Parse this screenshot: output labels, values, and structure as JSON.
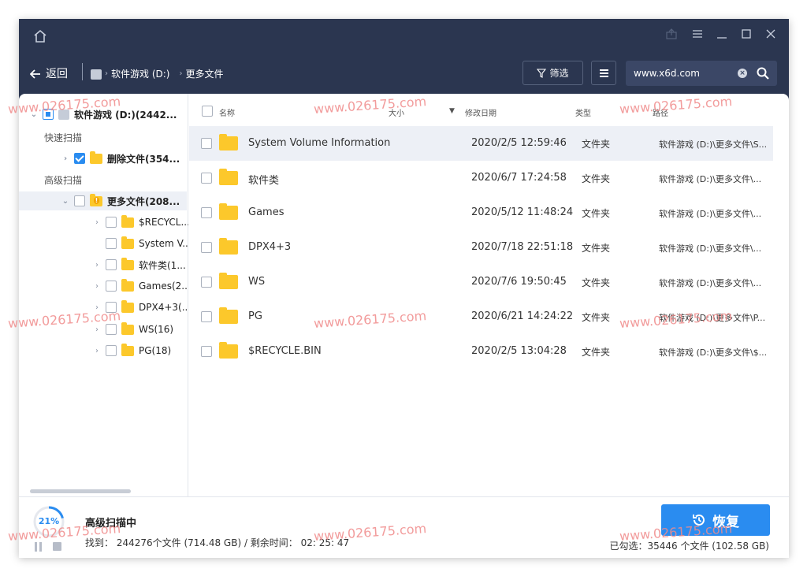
{
  "titlebar": {
    "icons": [
      "home-icon",
      "share-icon",
      "menu-icon",
      "minimize-icon",
      "maximize-icon",
      "close-icon"
    ]
  },
  "nav": {
    "back_label": "返回",
    "crumb_drive": "软件游戏 (D:)",
    "crumb_current": "更多文件",
    "filter_label": "筛选",
    "search_value": "www.x6d.com"
  },
  "sidebar": {
    "root": "软件游戏 (D:)(2442...",
    "quick_scan": "快速扫描",
    "deleted": "删除文件(354...",
    "advanced_scan": "高级扫描",
    "more_files": "更多文件(208...",
    "children": [
      "$RECYCL...",
      "System V...",
      "软件类(1...",
      "Games(2...",
      "DPX4+3(...",
      "WS(16)",
      "PG(18)"
    ]
  },
  "table": {
    "headers": {
      "name": "名称",
      "size": "大小",
      "date": "修改日期",
      "type": "类型",
      "path": "路径"
    },
    "rows": [
      {
        "name": "System Volume Information",
        "date": "2020/2/5 12:59:46",
        "type": "文件夹",
        "path": "软件游戏 (D:)\\更多文件\\S..."
      },
      {
        "name": "软件类",
        "date": "2020/6/7 17:24:58",
        "type": "文件夹",
        "path": "软件游戏 (D:)\\更多文件\\..."
      },
      {
        "name": "Games",
        "date": "2020/5/12 11:48:24",
        "type": "文件夹",
        "path": "软件游戏 (D:)\\更多文件\\..."
      },
      {
        "name": "DPX4+3",
        "date": "2020/7/18 22:51:18",
        "type": "文件夹",
        "path": "软件游戏 (D:)\\更多文件\\..."
      },
      {
        "name": "WS",
        "date": "2020/7/6 19:50:45",
        "type": "文件夹",
        "path": "软件游戏 (D:)\\更多文件\\..."
      },
      {
        "name": "PG",
        "date": "2020/6/21 14:24:22",
        "type": "文件夹",
        "path": "软件游戏 (D:)\\更多文件\\P..."
      },
      {
        "name": "$RECYCLE.BIN",
        "date": "2020/2/5 13:04:28",
        "type": "文件夹",
        "path": "软件游戏 (D:)\\更多文件\\$..."
      }
    ]
  },
  "footer": {
    "progress": 0.21,
    "progress_label": "21%",
    "scan_title": "高级扫描中",
    "scan_info": "找到： 244276个文件 (714.48 GB) / 剩余时间： 02: 25: 47",
    "recover_label": "恢复",
    "selected_info": "已勾选：35446 个文件 (102.58 GB)"
  },
  "watermark": "www.026175.com",
  "colors": {
    "header_bg": "#2b3650",
    "accent": "#2a8cf0",
    "folder": "#fcc82b",
    "watermark": "#f08b8b"
  }
}
